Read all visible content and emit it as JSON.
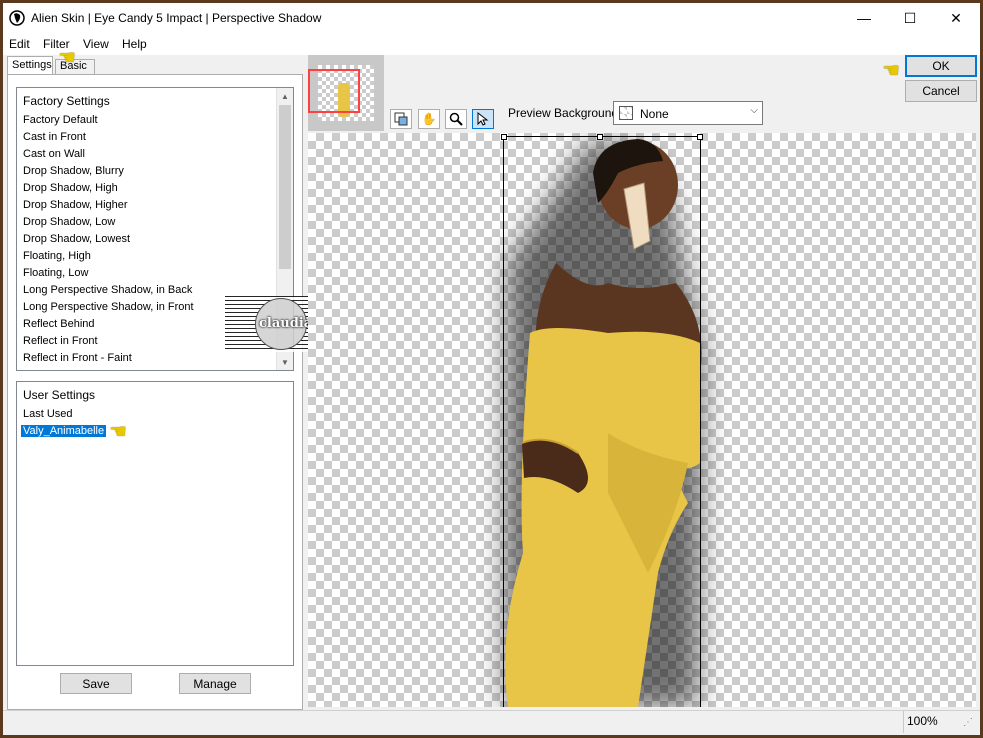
{
  "window": {
    "title": "Alien Skin | Eye Candy 5 Impact | Perspective Shadow",
    "controls": {
      "minimize": "—",
      "maximize": "☐",
      "close": "✕"
    }
  },
  "menu": [
    "Edit",
    "Filter",
    "View",
    "Help"
  ],
  "tabs": {
    "settings": "Settings",
    "basic": "Basic"
  },
  "factory_settings": {
    "header": "Factory Settings",
    "items": [
      "Factory Default",
      "Cast in Front",
      "Cast on Wall",
      "Drop Shadow, Blurry",
      "Drop Shadow, High",
      "Drop Shadow, Higher",
      "Drop Shadow, Low",
      "Drop Shadow, Lowest",
      "Floating, High",
      "Floating, Low",
      "Long Perspective Shadow, in Back",
      "Long Perspective Shadow, in Front",
      "Reflect Behind",
      "Reflect in Front",
      "Reflect in Front - Faint"
    ]
  },
  "user_settings": {
    "header": "User Settings",
    "items": [
      "Last Used",
      "Valy_Animabelle"
    ],
    "selected_index": 1
  },
  "buttons": {
    "save": "Save",
    "manage": "Manage",
    "ok": "OK",
    "cancel": "Cancel"
  },
  "watermark_text": "claudia",
  "preview_background": {
    "label": "Preview Background:",
    "value": "None"
  },
  "tools": [
    "preview-toggle-icon",
    "hand-pan-icon",
    "zoom-icon",
    "pointer-arrow-icon"
  ],
  "status": {
    "zoom": "100%"
  },
  "colors": {
    "selection": "#0078d7",
    "dress": "#e8c547",
    "frame": "#5a3a1e"
  }
}
